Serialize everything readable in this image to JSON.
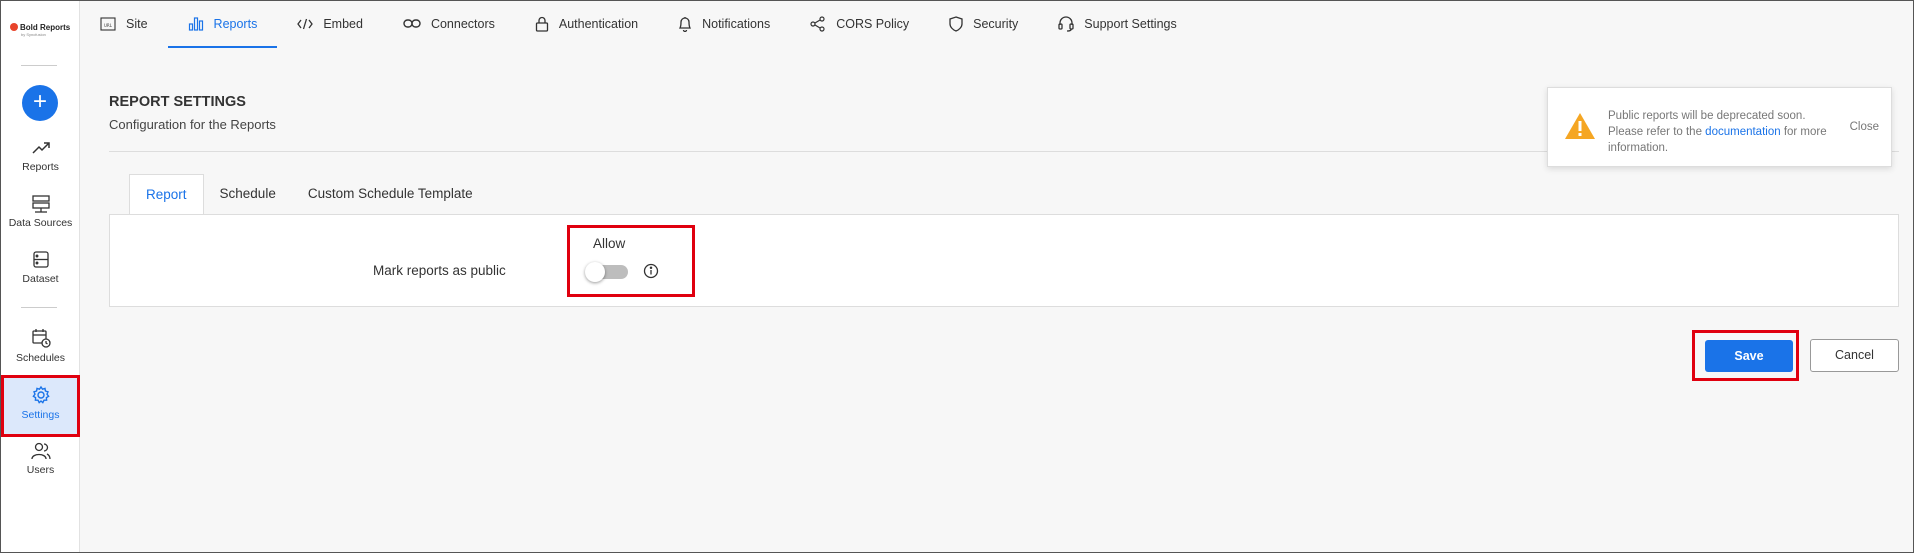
{
  "brand": {
    "name": "Bold Reports",
    "tagline": "by Syncfusion"
  },
  "sidebar": {
    "add_label": "+",
    "items": [
      {
        "label": "Reports",
        "icon": "trending-up-icon"
      },
      {
        "label": "Data Sources",
        "icon": "server-icon"
      },
      {
        "label": "Dataset",
        "icon": "dataset-icon"
      },
      {
        "label": "Schedules",
        "icon": "calendar-clock-icon"
      },
      {
        "label": "Settings",
        "icon": "gear-icon",
        "active": true
      },
      {
        "label": "Users",
        "icon": "users-icon"
      }
    ]
  },
  "topnav": {
    "tabs": [
      {
        "label": "Site",
        "icon": "url-icon"
      },
      {
        "label": "Reports",
        "icon": "bar-chart-icon",
        "active": true
      },
      {
        "label": "Embed",
        "icon": "code-icon"
      },
      {
        "label": "Connectors",
        "icon": "link-icon"
      },
      {
        "label": "Authentication",
        "icon": "lock-icon"
      },
      {
        "label": "Notifications",
        "icon": "bell-icon"
      },
      {
        "label": "CORS Policy",
        "icon": "share-icon"
      },
      {
        "label": "Security",
        "icon": "shield-icon"
      },
      {
        "label": "Support Settings",
        "icon": "headset-icon"
      }
    ]
  },
  "page": {
    "title": "REPORT SETTINGS",
    "subtitle": "Configuration for the Reports"
  },
  "toast": {
    "line1": "Public reports will be deprecated soon.",
    "line2_pre": "Please refer to the ",
    "link": "documentation",
    "line2_post": " for more information.",
    "close": "Close"
  },
  "inner_tabs": [
    {
      "label": "Report",
      "active": true
    },
    {
      "label": "Schedule"
    },
    {
      "label": "Custom Schedule Template"
    }
  ],
  "form": {
    "field_label": "Mark reports as public",
    "allow_label": "Allow",
    "toggle_on": false
  },
  "actions": {
    "save": "Save",
    "cancel": "Cancel"
  },
  "colors": {
    "accent": "#1a73e8",
    "highlight": "#e0000f",
    "warning": "#f5a623"
  }
}
